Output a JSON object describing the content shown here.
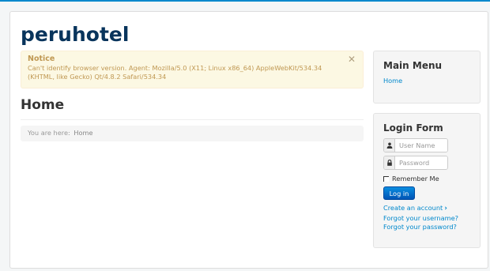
{
  "site": {
    "title": "peruhotel"
  },
  "notice": {
    "heading": "Notice",
    "message": "Can't identify browser version. Agent: Mozilla/5.0 (X11; Linux x86_64) AppleWebKit/534.34 (KHTML, like Gecko) Qt/4.8.2 Safari/534.34",
    "close_symbol": "✕"
  },
  "page": {
    "heading": "Home"
  },
  "breadcrumb": {
    "prefix": "You are here:",
    "current": "Home"
  },
  "main_menu": {
    "title": "Main Menu",
    "items": [
      {
        "label": "Home"
      }
    ]
  },
  "login_form": {
    "title": "Login Form",
    "username_placeholder": "User Name",
    "password_placeholder": "Password",
    "user_icon": "user-icon",
    "lock_icon": "lock-icon",
    "remember_label": "Remember Me",
    "submit_label": "Log in",
    "links": {
      "create_account": "Create an account",
      "forgot_username": "Forgot your username?",
      "forgot_password": "Forgot your password?"
    }
  },
  "colors": {
    "accent": "#0088cc",
    "title": "#08345c",
    "notice_text": "#c09853",
    "notice_bg": "#fcf8e3"
  }
}
